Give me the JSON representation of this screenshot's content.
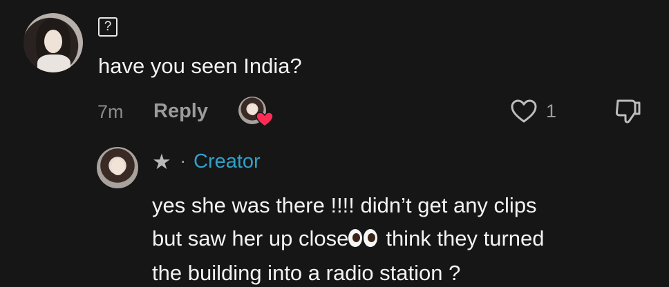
{
  "comment": {
    "unknown_glyph": "?",
    "text": "have you seen India?",
    "time": "7m",
    "reply_label": "Reply",
    "like_count": "1",
    "accent_heart_color": "#fe2c55"
  },
  "reply": {
    "badge": "★",
    "separator": "·",
    "creator_label": "Creator",
    "creator_color": "#2fa2c9",
    "line1": "yes she was there !!!! didn’t get any clips",
    "line2_before": "but saw her up close",
    "line2_emoji": "eyes-emoji",
    "line2_after": "think they turned",
    "line3": "the building into a radio station ?"
  }
}
